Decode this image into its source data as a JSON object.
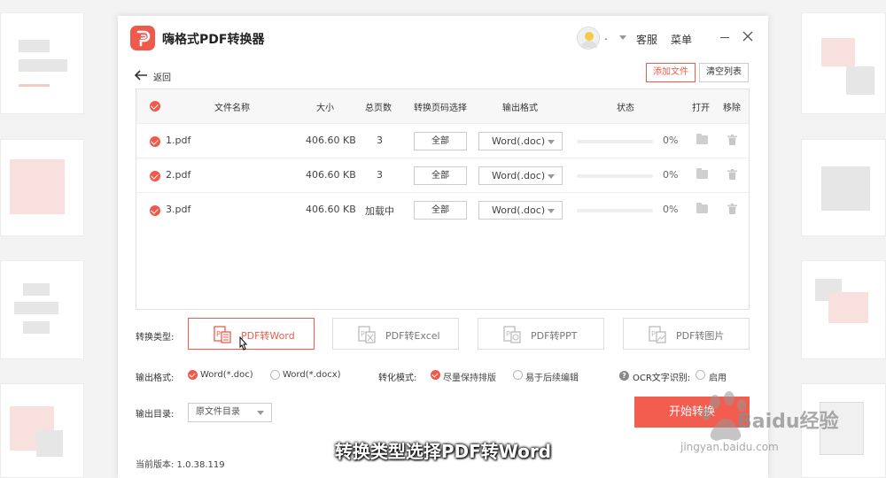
{
  "app": {
    "title": "嗨格式PDF转换器",
    "user_name": ".",
    "service": "客服",
    "menu": "菜单"
  },
  "toolbar": {
    "back": "返回",
    "add_file": "添加文件",
    "clear_list": "清空列表"
  },
  "table": {
    "headers": {
      "name": "文件名称",
      "size": "大小",
      "pages": "总页数",
      "page_select": "转换页码选择",
      "format": "输出格式",
      "status": "状态",
      "open": "打开",
      "remove": "移除"
    },
    "rows": [
      {
        "name": "1.pdf",
        "size": "406.60 KB",
        "pages": "3",
        "page_range": "全部",
        "format": "Word(.doc)",
        "progress": 0,
        "pct": "0%"
      },
      {
        "name": "2.pdf",
        "size": "406.60 KB",
        "pages": "3",
        "page_range": "全部",
        "format": "Word(.doc)",
        "progress": 0,
        "pct": "0%"
      },
      {
        "name": "3.pdf",
        "size": "406.60 KB",
        "pages": "加载中",
        "page_range": "全部",
        "format": "Word(.doc)",
        "progress": 0,
        "pct": "0%"
      }
    ]
  },
  "conversion": {
    "type_label": "转换类型:",
    "types": [
      "PDF转Word",
      "PDF转Excel",
      "PDF转PPT",
      "PDF转图片"
    ],
    "selected_type": "PDF转Word",
    "output_format_label": "输出格式:",
    "output_formats": [
      "Word(*.doc)",
      "Word(*.docx)"
    ],
    "mode_label": "转化模式:",
    "modes": [
      "尽量保持排版",
      "易于后续编辑"
    ],
    "ocr_label": "OCR文字识别:",
    "ocr_option": "启用",
    "output_dir_label": "输出目录:",
    "output_dir_value": "原文件目录",
    "start": "开始转换"
  },
  "footer": {
    "version": "当前版本: 1.0.38.119"
  },
  "overlay": {
    "subtitle": "转换类型选择PDF转Word",
    "watermark": "Baidu经验",
    "watermark_url": "jingyan.baidu.com"
  },
  "colors": {
    "accent": "#f05a4a",
    "background": "#f3f3f3"
  }
}
